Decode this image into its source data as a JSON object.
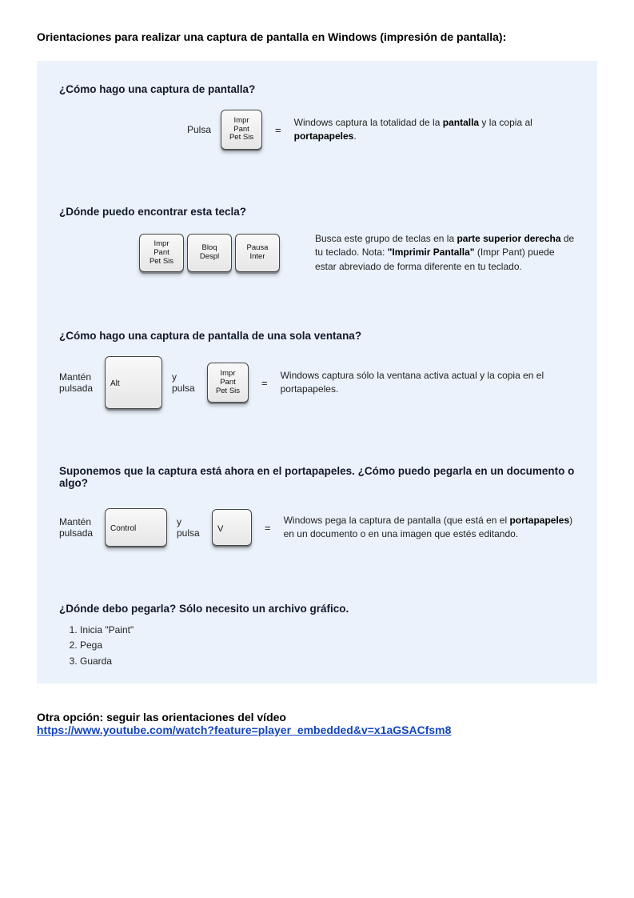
{
  "title": "Orientaciones para realizar una captura de pantalla en Windows (impresión de pantalla):",
  "panel": {
    "q1": {
      "heading": "¿Cómo hago una captura de pantalla?",
      "pulsa": "Pulsa",
      "key": {
        "l1": "Impr",
        "l2": "Pant",
        "l3": "Pet Sis"
      },
      "eq": "=",
      "desc_pre": "Windows captura la totalidad de la ",
      "desc_b1": "pantalla",
      "desc_mid": " y la copia al ",
      "desc_b2": "portapapeles",
      "desc_post": "."
    },
    "q2": {
      "heading": "¿Dónde puedo encontrar esta tecla?",
      "keys": [
        {
          "l1": "Impr",
          "l2": "Pant",
          "l3": "Pet Sis"
        },
        {
          "l1": "Bloq",
          "l2": "Despl",
          "l3": ""
        },
        {
          "l1": "Pausa",
          "l2": "",
          "l3": "Inter"
        }
      ],
      "desc_pre": "Busca este grupo de teclas en la ",
      "desc_b1": "parte superior derecha",
      "desc_mid": " de tu teclado. Nota: ",
      "desc_b2": "\"Imprimir Pantalla\"",
      "desc_post": " (Impr Pant) puede estar abreviado de forma diferente en tu teclado."
    },
    "q3": {
      "heading": "¿Cómo hago una captura de pantalla de una sola ventana?",
      "manten": "Mantén pulsada",
      "keyAlt": "Alt",
      "y_pulsa": "y pulsa",
      "keyPrint": {
        "l1": "Impr",
        "l2": "Pant",
        "l3": "Pet Sis"
      },
      "eq": "=",
      "desc": "Windows captura sólo la ventana activa actual y la copia en el portapapeles."
    },
    "q4": {
      "heading": "Suponemos que la captura está ahora en el portapapeles. ¿Cómo puedo pegarla en un documento o algo?",
      "manten": "Mantén pulsada",
      "keyCtrl": "Control",
      "y_pulsa": "y pulsa",
      "keyV": "V",
      "eq": "=",
      "desc_pre": "Windows pega la captura de pantalla (que está en el ",
      "desc_b1": "portapapeles",
      "desc_post": ") en un documento o en una imagen que estés editando."
    },
    "q5": {
      "heading": "¿Dónde debo pegarla? Sólo necesito un archivo gráfico.",
      "steps": [
        "Inicia \"Paint\"",
        "Pega",
        "Guarda"
      ]
    }
  },
  "footer": {
    "text": "Otra opción: seguir las orientaciones del vídeo",
    "link": "https://www.youtube.com/watch?feature=player_embedded&v=x1aGSACfsm8"
  }
}
